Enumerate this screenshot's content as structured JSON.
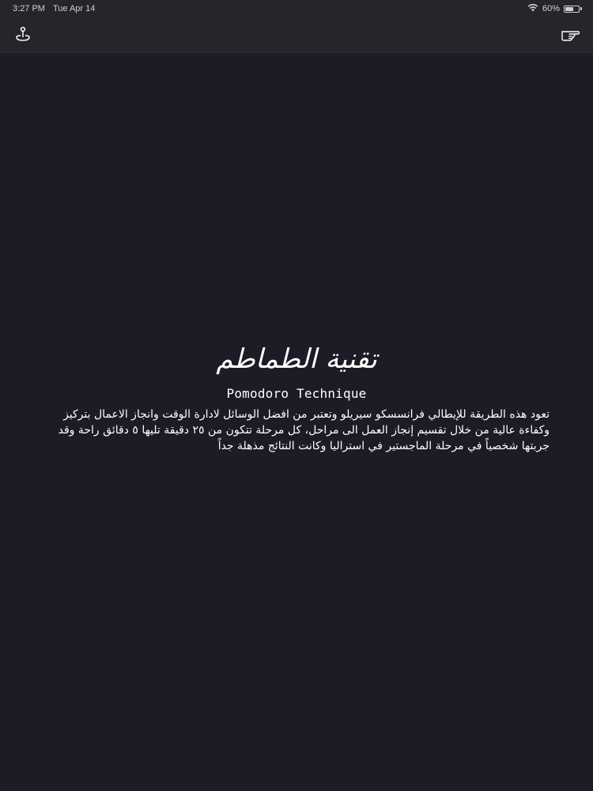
{
  "status_bar": {
    "time": "3:27 PM",
    "date": "Tue Apr 14",
    "battery_percent": "60%",
    "battery_level": 0.6,
    "wifi_icon": "wifi-icon",
    "battery_icon": "battery-icon"
  },
  "nav": {
    "left_icon": "joystick-icon",
    "right_icon": "pointing-hand-icon"
  },
  "main": {
    "title_ar": "تقنية الطماطم",
    "title_en": "Pomodoro Technique",
    "description": "تعود هذه الطريقة للإيطالي فرانسسكو سيريلو وتعتبر من افضل الوسائل لادارة الوقت وانجاز الاعمال بتركيز وكفاءة عالية من خلال تقسيم إنجاز العمل الى مراحل، كل مرحلة تتكون من ٢٥ دقيقة تليها ٥ دقائق راحة وقد جربتها شخصياً في مرحلة الماجستير في استراليا وكانت النتائج مذهلة جداً"
  },
  "colors": {
    "background": "#1c1b26",
    "bar": "#25252c",
    "text": "#ffffff"
  }
}
